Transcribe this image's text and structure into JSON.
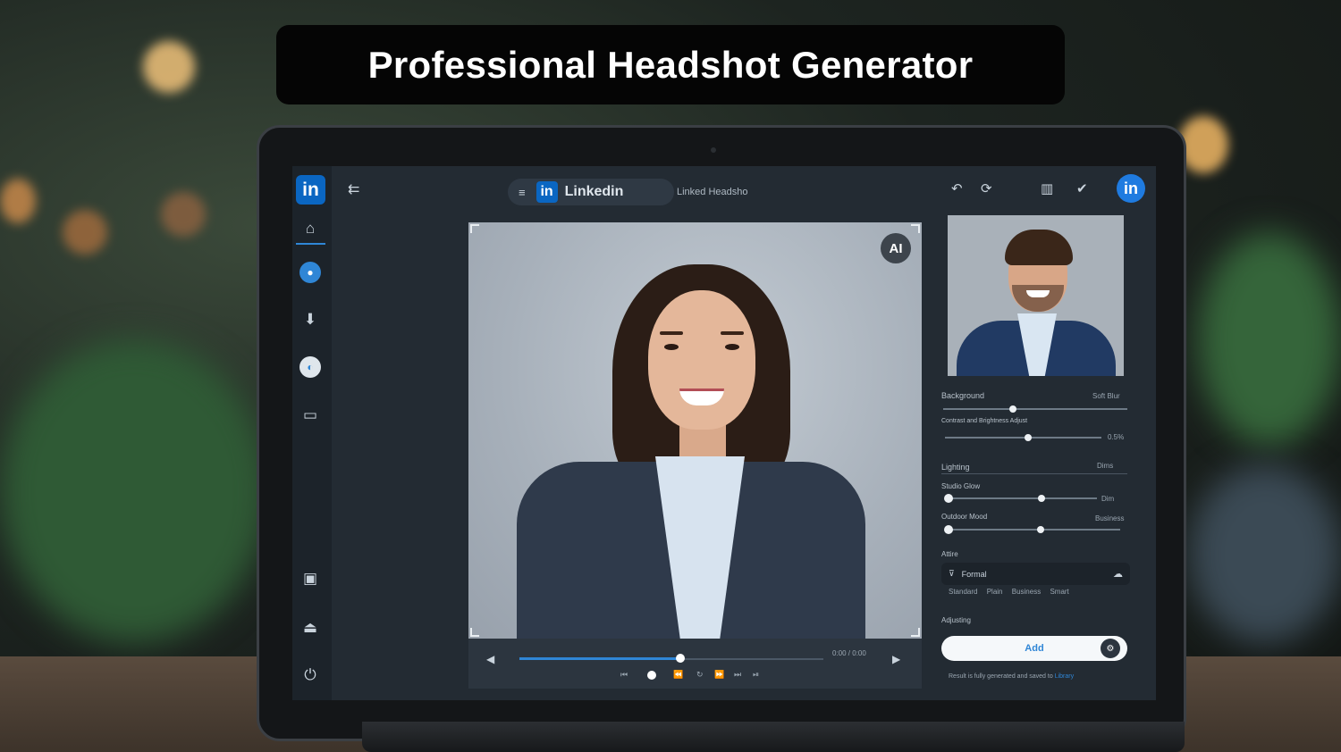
{
  "banner": {
    "title": "Professional Headshot Generator"
  },
  "app": {
    "brand_short": "in",
    "brand_name": "Linkedin",
    "caption": "Linked Headsho",
    "ai_badge": "AI",
    "avatar": "in"
  },
  "rail": {
    "icons": [
      "home-icon",
      "profile-icon",
      "download-icon",
      "globe-icon",
      "gallery-icon",
      "image-icon",
      "upload-icon",
      "power-icon"
    ]
  },
  "player": {
    "progress": 0.53,
    "time": "0:00 / 0:00"
  },
  "panel": {
    "sliders": [
      {
        "label": "Background",
        "value_text": "Soft Blur",
        "level": 0.38
      },
      {
        "label": "Contrast and Brightness Adjust",
        "value_text": "0.5%",
        "level": 0.53
      },
      {
        "label": "Lighting",
        "value_text": "Dims",
        "level": null
      },
      {
        "label": "Studio Glow",
        "value_text": "Dim",
        "level": 0.63
      },
      {
        "label": "Outdoor Mood",
        "value_text": "Business",
        "level": 0.54
      }
    ],
    "attire_label": "Attire",
    "attire_value": "Formal",
    "attire_options": [
      "Standard",
      "Plain",
      "Business",
      "Smart"
    ],
    "adjust_label": "Adjusting",
    "add_button": "Add",
    "footer": "Result is fully generated and saved to ",
    "footer_link": "Library"
  },
  "colors": {
    "accent": "#2f86d6",
    "brand": "#0a66c2"
  }
}
